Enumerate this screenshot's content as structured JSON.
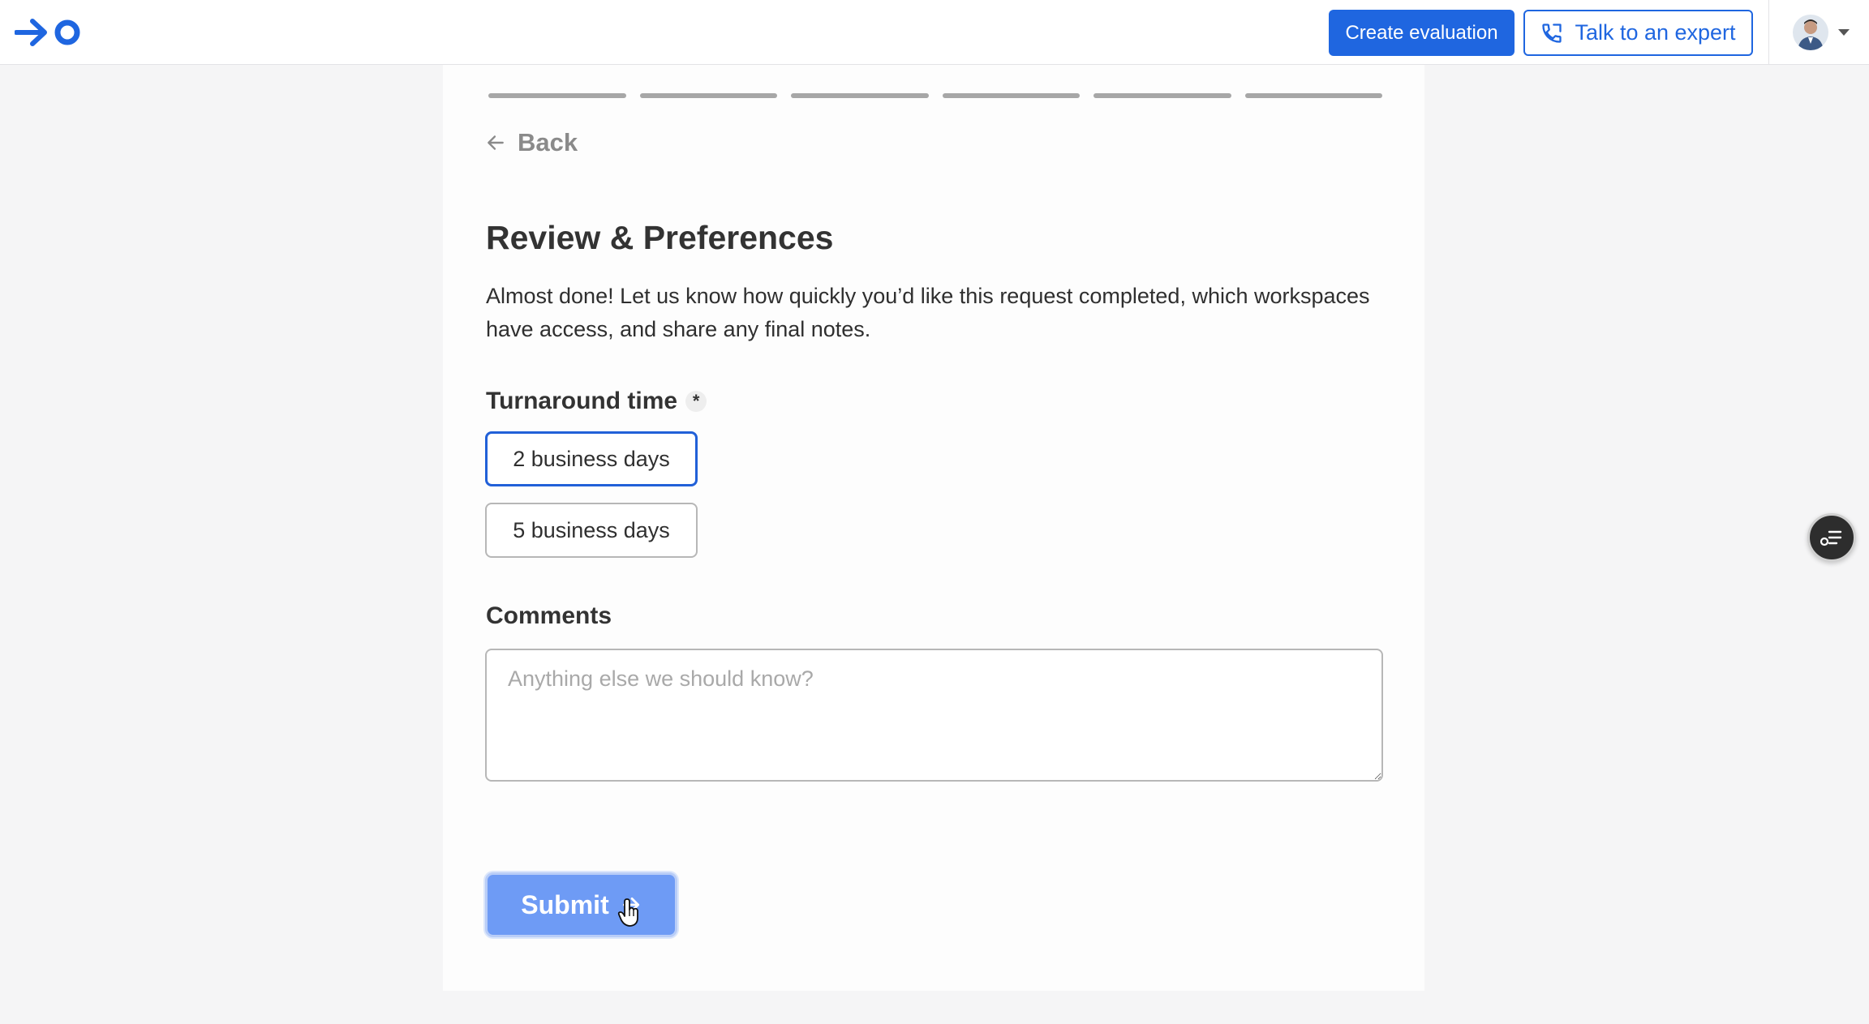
{
  "header": {
    "logo_icon": "arrow-ring-logo-icon",
    "create_label": "Create evaluation",
    "expert_label": "Talk to an expert",
    "expert_icon": "phone-icon",
    "avatar_icon": "user-avatar",
    "brand_color": "#1f66e0"
  },
  "progress": {
    "steps_total": 6
  },
  "nav": {
    "back_label": "Back",
    "back_icon": "arrow-left-icon"
  },
  "form": {
    "title": "Review & Preferences",
    "description": "Almost done! Let us know how quickly you’d like this request completed, which workspaces have access, and share any final notes.",
    "turnaround": {
      "label": "Turnaround time",
      "required_marker": "*",
      "options": [
        {
          "label": "2 business days",
          "selected": true
        },
        {
          "label": "5 business days",
          "selected": false
        }
      ]
    },
    "comments": {
      "label": "Comments",
      "placeholder": "Anything else we should know?",
      "value": ""
    },
    "submit_label": "Submit",
    "submit_icon": "arrow-right-icon",
    "submit_color": "#6e9bf5"
  },
  "floating": {
    "icon": "task-list-icon"
  }
}
